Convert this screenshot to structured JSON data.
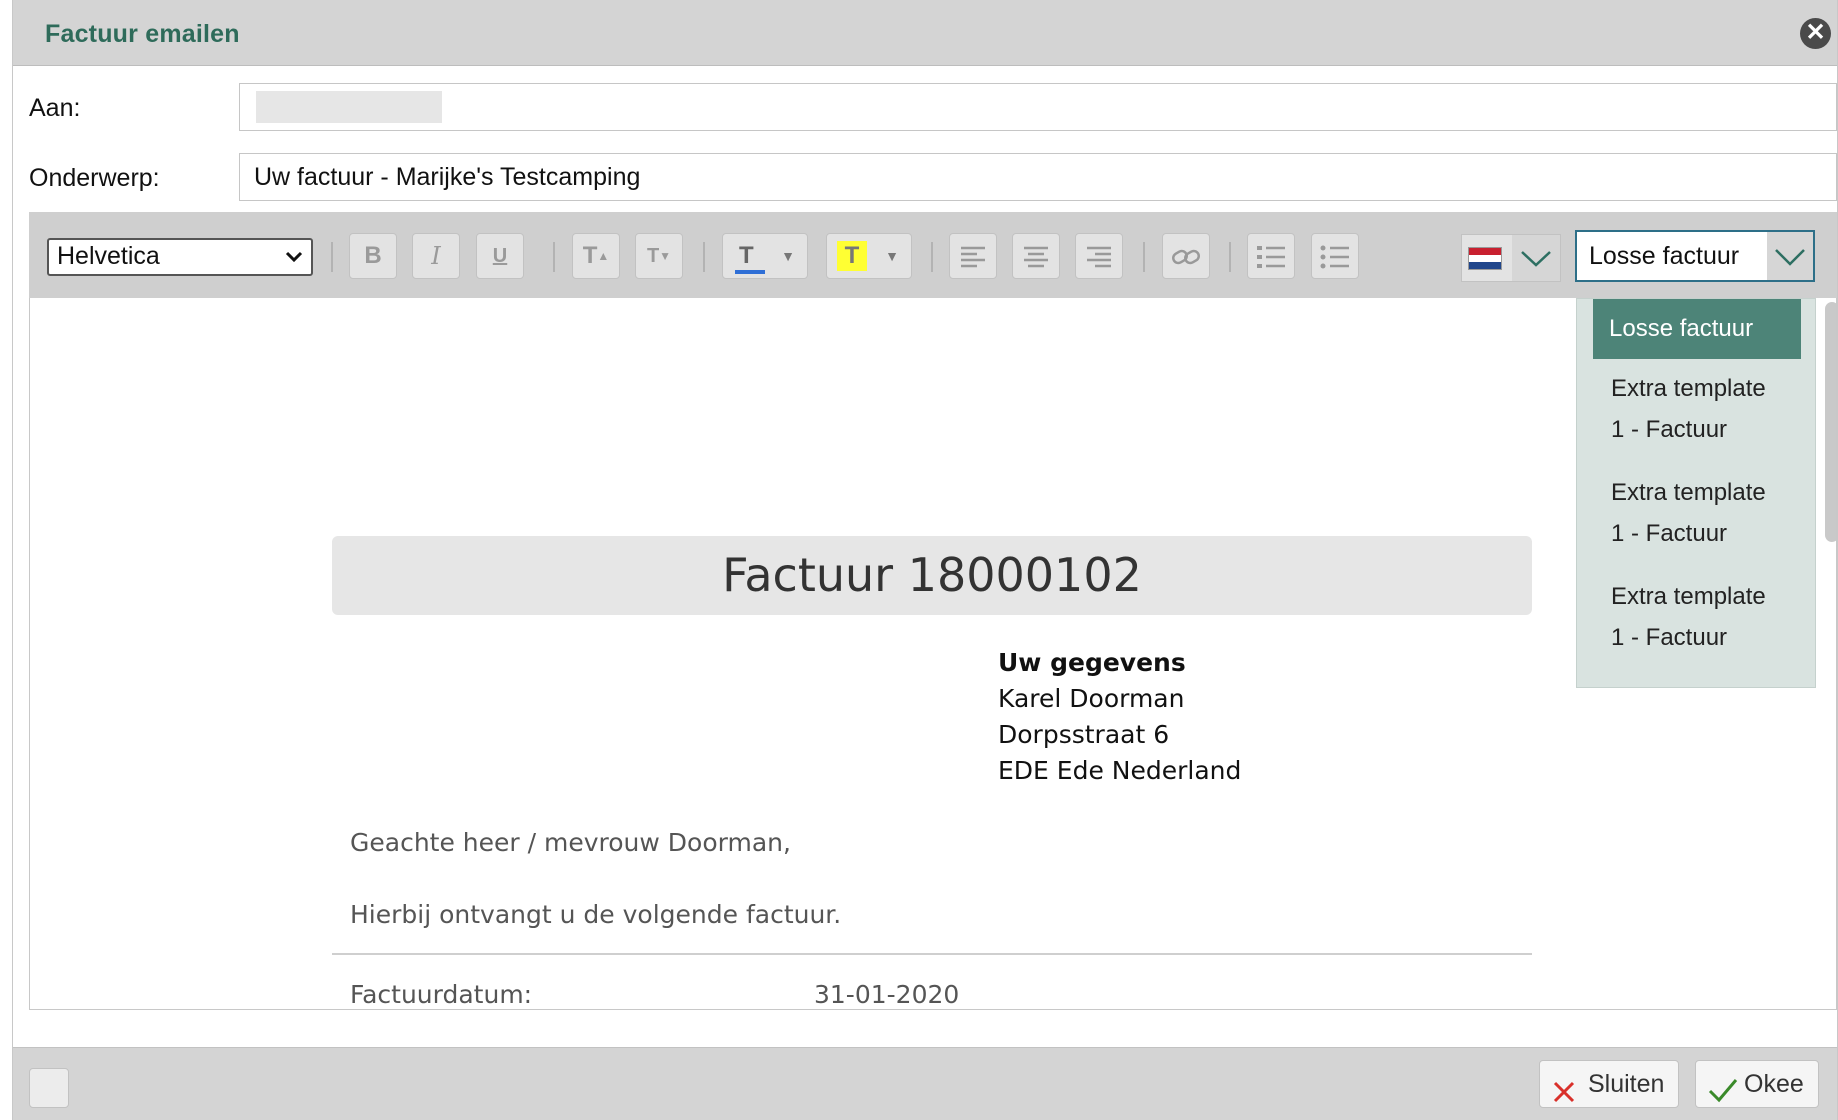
{
  "dialog": {
    "title": "Factuur emailen"
  },
  "form": {
    "to_label": "Aan:",
    "to_value": "",
    "subject_label": "Onderwerp:",
    "subject_value": "Uw factuur - Marijke's Testcamping"
  },
  "toolbar": {
    "font": "Helvetica",
    "buttons": [
      "bold",
      "italic",
      "underline",
      "superscript",
      "subscript",
      "text-color",
      "highlight",
      "align-left",
      "align-center",
      "align-right",
      "link",
      "ordered-list",
      "unordered-list"
    ],
    "language_flag": "nl-flag",
    "template_selected": "Losse factuur"
  },
  "template_dropdown": {
    "selected": "Losse factuur",
    "options": [
      {
        "line1": "Extra template",
        "line2": "1 - Factuur"
      },
      {
        "line1": "Extra template",
        "line2": "1 - Factuur"
      },
      {
        "line1": "Extra template",
        "line2": "1 - Factuur"
      }
    ]
  },
  "document": {
    "title": "Factuur 18000102",
    "address_heading": "Uw gegevens",
    "address_name": "Karel Doorman",
    "address_street": "Dorpsstraat 6",
    "address_city": "EDE Ede Nederland",
    "greeting": "Geachte heer / mevrouw Doorman,",
    "intro": "Hierbij ontvangt u de volgende factuur.",
    "date_label": "Factuurdatum:",
    "date_value": "31-01-2020"
  },
  "footer": {
    "close_label": "Sluiten",
    "ok_label": "Okee"
  },
  "colors": {
    "accent": "#2e6b5a",
    "selected_option": "#4d8478",
    "dropdown_bg": "#d9e3e0",
    "highlight": "#ffff33",
    "text_color_bar": "#2f6fd6"
  }
}
